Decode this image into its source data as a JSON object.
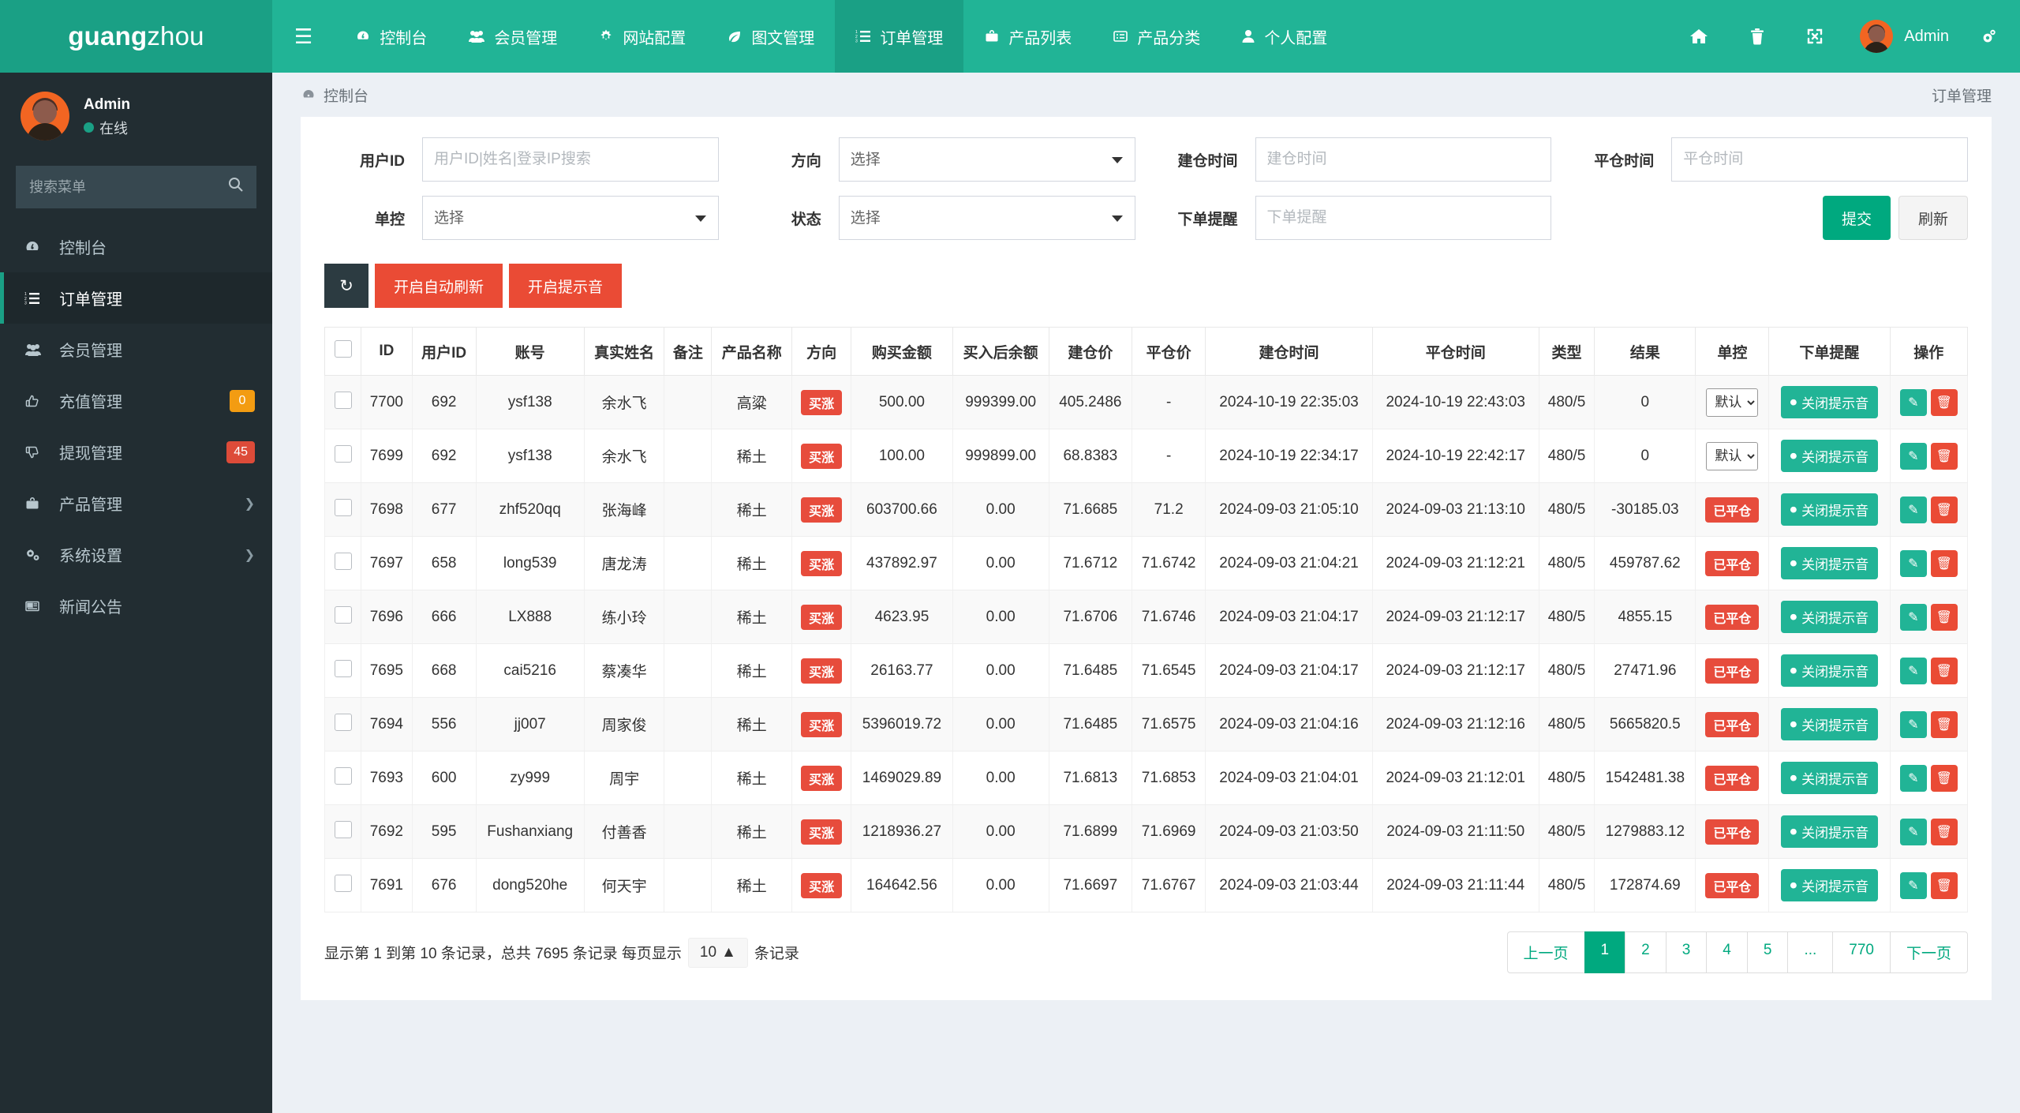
{
  "brand": {
    "bold": "guang",
    "rest": "zhou"
  },
  "sidebar": {
    "user": {
      "name": "Admin",
      "status": "在线"
    },
    "search_placeholder": "搜索菜单",
    "items": [
      {
        "label": "控制台",
        "icon": "dashboard-icon",
        "badge": null,
        "arrow": false,
        "active": false
      },
      {
        "label": "订单管理",
        "icon": "order-list-icon",
        "badge": null,
        "arrow": false,
        "active": true
      },
      {
        "label": "会员管理",
        "icon": "users-icon",
        "badge": null,
        "arrow": false,
        "active": false
      },
      {
        "label": "充值管理",
        "icon": "thumbs-up-icon",
        "badge": "0",
        "badge_color": "#f39c12",
        "arrow": false,
        "active": false
      },
      {
        "label": "提现管理",
        "icon": "thumbs-down-icon",
        "badge": "45",
        "badge_color": "#dd4b39",
        "arrow": false,
        "active": false
      },
      {
        "label": "产品管理",
        "icon": "briefcase-icon",
        "badge": null,
        "arrow": true,
        "active": false
      },
      {
        "label": "系统设置",
        "icon": "gears-icon",
        "badge": null,
        "arrow": true,
        "active": false
      },
      {
        "label": "新闻公告",
        "icon": "newspaper-icon",
        "badge": null,
        "arrow": false,
        "active": false
      }
    ]
  },
  "navbar": {
    "hamburger": "menu-icon",
    "items": [
      {
        "label": "控制台",
        "icon": "dashboard-icon",
        "active": false
      },
      {
        "label": "会员管理",
        "icon": "users-icon",
        "active": false
      },
      {
        "label": "网站配置",
        "icon": "gear-icon",
        "active": false
      },
      {
        "label": "图文管理",
        "icon": "leaf-icon",
        "active": false
      },
      {
        "label": "订单管理",
        "icon": "order-list-icon",
        "active": true
      },
      {
        "label": "产品列表",
        "icon": "briefcase-icon",
        "active": false
      },
      {
        "label": "产品分类",
        "icon": "list-alt-icon",
        "active": false
      },
      {
        "label": "个人配置",
        "icon": "user-icon",
        "active": false
      }
    ],
    "right_icons": [
      "home-icon",
      "trash-icon",
      "fullscreen-icon"
    ],
    "user_label": "Admin",
    "settings_icon": "gears-icon"
  },
  "content_header": {
    "breadcrumb": "控制台",
    "right": "订单管理"
  },
  "filters": {
    "user_id": {
      "label": "用户ID",
      "placeholder": "用户ID|姓名|登录IP搜索",
      "value": ""
    },
    "direction": {
      "label": "方向",
      "selected": "选择"
    },
    "open_time": {
      "label": "建仓时间",
      "placeholder": "建仓时间",
      "value": ""
    },
    "close_time": {
      "label": "平仓时间",
      "placeholder": "平仓时间",
      "value": ""
    },
    "single_control": {
      "label": "单控",
      "selected": "选择"
    },
    "status": {
      "label": "状态",
      "selected": "选择"
    },
    "order_remind": {
      "label": "下单提醒",
      "placeholder": "下单提醒",
      "value": ""
    },
    "submit_label": "提交",
    "refresh_label": "刷新"
  },
  "toolbar": {
    "refresh_icon": "refresh-icon",
    "auto_refresh_label": "开启自动刷新",
    "sound_label": "开启提示音"
  },
  "table": {
    "columns": [
      "",
      "ID",
      "用户ID",
      "账号",
      "真实姓名",
      "备注",
      "产品名称",
      "方向",
      "购买金额",
      "买入后余额",
      "建仓价",
      "平仓价",
      "建仓时间",
      "平仓时间",
      "类型",
      "结果",
      "单控",
      "下单提醒",
      "操作"
    ],
    "remind_button_label": "关闭提示音",
    "control_default": "默认",
    "rows": [
      {
        "id": "7700",
        "user_id": "692",
        "account": "ysf138",
        "real_name": "余水飞",
        "note": "",
        "product": "高粱",
        "direction": "买涨",
        "amount": "500.00",
        "balance_after": "999399.00",
        "open_price": "405.2486",
        "close_price": "-",
        "open_time": "2024-10-19 22:35:03",
        "close_time": "2024-10-19 22:43:03",
        "type": "480/5",
        "result": "0",
        "control": "默认",
        "control_kind": "select"
      },
      {
        "id": "7699",
        "user_id": "692",
        "account": "ysf138",
        "real_name": "余水飞",
        "note": "",
        "product": "稀土",
        "direction": "买涨",
        "amount": "100.00",
        "balance_after": "999899.00",
        "open_price": "68.8383",
        "close_price": "-",
        "open_time": "2024-10-19 22:34:17",
        "close_time": "2024-10-19 22:42:17",
        "type": "480/5",
        "result": "0",
        "control": "默认",
        "control_kind": "select"
      },
      {
        "id": "7698",
        "user_id": "677",
        "account": "zhf520qq",
        "real_name": "张海峰",
        "note": "",
        "product": "稀土",
        "direction": "买涨",
        "amount": "603700.66",
        "balance_after": "0.00",
        "open_price": "71.6685",
        "close_price": "71.2",
        "open_time": "2024-09-03 21:05:10",
        "close_time": "2024-09-03 21:13:10",
        "type": "480/5",
        "result": "-30185.03",
        "control": "已平仓",
        "control_kind": "badge"
      },
      {
        "id": "7697",
        "user_id": "658",
        "account": "long539",
        "real_name": "唐龙涛",
        "note": "",
        "product": "稀土",
        "direction": "买涨",
        "amount": "437892.97",
        "balance_after": "0.00",
        "open_price": "71.6712",
        "close_price": "71.6742",
        "open_time": "2024-09-03 21:04:21",
        "close_time": "2024-09-03 21:12:21",
        "type": "480/5",
        "result": "459787.62",
        "control": "已平仓",
        "control_kind": "badge"
      },
      {
        "id": "7696",
        "user_id": "666",
        "account": "LX888",
        "real_name": "练小玲",
        "note": "",
        "product": "稀土",
        "direction": "买涨",
        "amount": "4623.95",
        "balance_after": "0.00",
        "open_price": "71.6706",
        "close_price": "71.6746",
        "open_time": "2024-09-03 21:04:17",
        "close_time": "2024-09-03 21:12:17",
        "type": "480/5",
        "result": "4855.15",
        "control": "已平仓",
        "control_kind": "badge"
      },
      {
        "id": "7695",
        "user_id": "668",
        "account": "cai5216",
        "real_name": "蔡凑华",
        "note": "",
        "product": "稀土",
        "direction": "买涨",
        "amount": "26163.77",
        "balance_after": "0.00",
        "open_price": "71.6485",
        "close_price": "71.6545",
        "open_time": "2024-09-03 21:04:17",
        "close_time": "2024-09-03 21:12:17",
        "type": "480/5",
        "result": "27471.96",
        "control": "已平仓",
        "control_kind": "badge"
      },
      {
        "id": "7694",
        "user_id": "556",
        "account": "jj007",
        "real_name": "周家俊",
        "note": "",
        "product": "稀土",
        "direction": "买涨",
        "amount": "5396019.72",
        "balance_after": "0.00",
        "open_price": "71.6485",
        "close_price": "71.6575",
        "open_time": "2024-09-03 21:04:16",
        "close_time": "2024-09-03 21:12:16",
        "type": "480/5",
        "result": "5665820.5",
        "control": "已平仓",
        "control_kind": "badge"
      },
      {
        "id": "7693",
        "user_id": "600",
        "account": "zy999",
        "real_name": "周宇",
        "note": "",
        "product": "稀土",
        "direction": "买涨",
        "amount": "1469029.89",
        "balance_after": "0.00",
        "open_price": "71.6813",
        "close_price": "71.6853",
        "open_time": "2024-09-03 21:04:01",
        "close_time": "2024-09-03 21:12:01",
        "type": "480/5",
        "result": "1542481.38",
        "control": "已平仓",
        "control_kind": "badge"
      },
      {
        "id": "7692",
        "user_id": "595",
        "account": "Fushanxiang",
        "real_name": "付善香",
        "note": "",
        "product": "稀土",
        "direction": "买涨",
        "amount": "1218936.27",
        "balance_after": "0.00",
        "open_price": "71.6899",
        "close_price": "71.6969",
        "open_time": "2024-09-03 21:03:50",
        "close_time": "2024-09-03 21:11:50",
        "type": "480/5",
        "result": "1279883.12",
        "control": "已平仓",
        "control_kind": "badge"
      },
      {
        "id": "7691",
        "user_id": "676",
        "account": "dong520he",
        "real_name": "何天宇",
        "note": "",
        "product": "稀土",
        "direction": "买涨",
        "amount": "164642.56",
        "balance_after": "0.00",
        "open_price": "71.6697",
        "close_price": "71.6767",
        "open_time": "2024-09-03 21:03:44",
        "close_time": "2024-09-03 21:11:44",
        "type": "480/5",
        "result": "172874.69",
        "control": "已平仓",
        "control_kind": "badge"
      }
    ]
  },
  "footer": {
    "info_prefix": "显示第 1 到第 10 条记录，总共 7695 条记录 每页显示",
    "page_size": "10",
    "info_suffix": "条记录",
    "pager": [
      "上一页",
      "1",
      "2",
      "3",
      "4",
      "5",
      "...",
      "770",
      "下一页"
    ],
    "active_page": "1"
  },
  "colors": {
    "brand_green": "#21b496",
    "dark_green": "#1aa085",
    "red": "#ea4b35",
    "sidebar": "#222d32"
  }
}
